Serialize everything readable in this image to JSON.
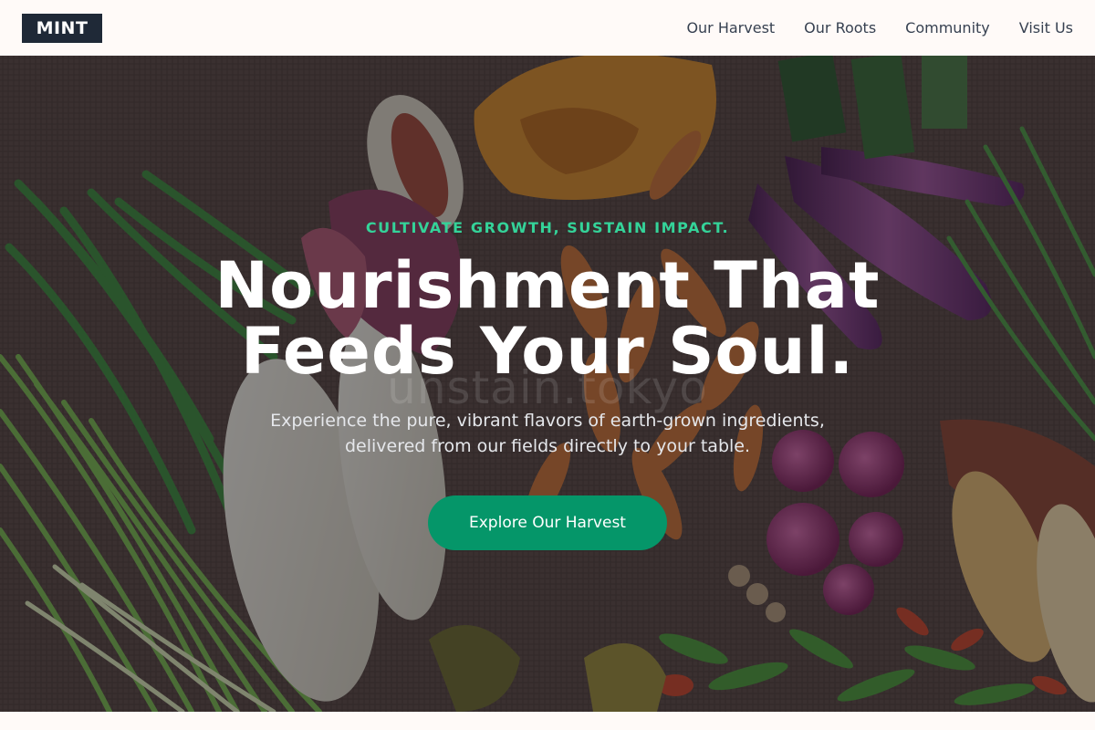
{
  "brand": {
    "logo_text": "MINT"
  },
  "nav": {
    "items": [
      {
        "label": "Our Harvest"
      },
      {
        "label": "Our Roots"
      },
      {
        "label": "Community"
      },
      {
        "label": "Visit Us"
      }
    ]
  },
  "hero": {
    "eyebrow": "CULTIVATE GROWTH, SUSTAIN IMPACT.",
    "headline_line1": "Nourishment That",
    "headline_line2": "Feeds Your Soul.",
    "watermark": "unstain.tokyo",
    "subtext": "Experience the pure, vibrant flavors of earth-grown ingredients, delivered from our fields directly to your table.",
    "cta_label": "Explore Our Harvest",
    "background": "vegetables-on-burlap-photo"
  },
  "colors": {
    "accent": "#059669",
    "eyebrow": "#34d399",
    "logo_bg": "#1f2937",
    "page_bg": "#fffaf8"
  }
}
